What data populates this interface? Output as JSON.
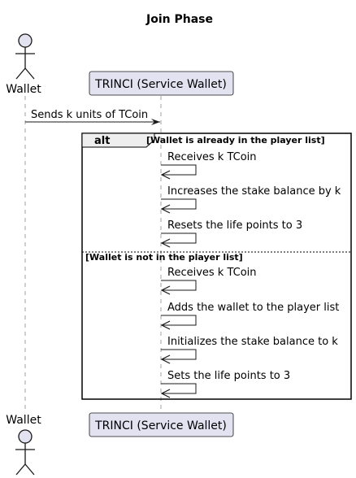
{
  "diagram": {
    "title": "Join Phase",
    "participants": {
      "wallet": "Wallet",
      "service": "TRINCI (Service Wallet)"
    },
    "first_message": "Sends k units of TCoin",
    "alt_fragment": {
      "operator": "alt",
      "branches": [
        {
          "guard": "[Wallet is already in the player list]",
          "messages": [
            "Receives k TCoin",
            "Increases the stake balance by k",
            "Resets the life points to 3"
          ]
        },
        {
          "guard": "[Wallet is not in the player list]",
          "messages": [
            "Receives k TCoin",
            "Adds the wallet to the player list",
            "Initializes the stake balance to k",
            "Sets the life points to 3"
          ]
        }
      ]
    },
    "colors": {
      "participant_fill": "#e2e2f0",
      "participant_stroke": "#181818",
      "lifeline": "#a0a0a0",
      "line": "#181818",
      "frame_tab_fill": "#eeeeee"
    }
  }
}
